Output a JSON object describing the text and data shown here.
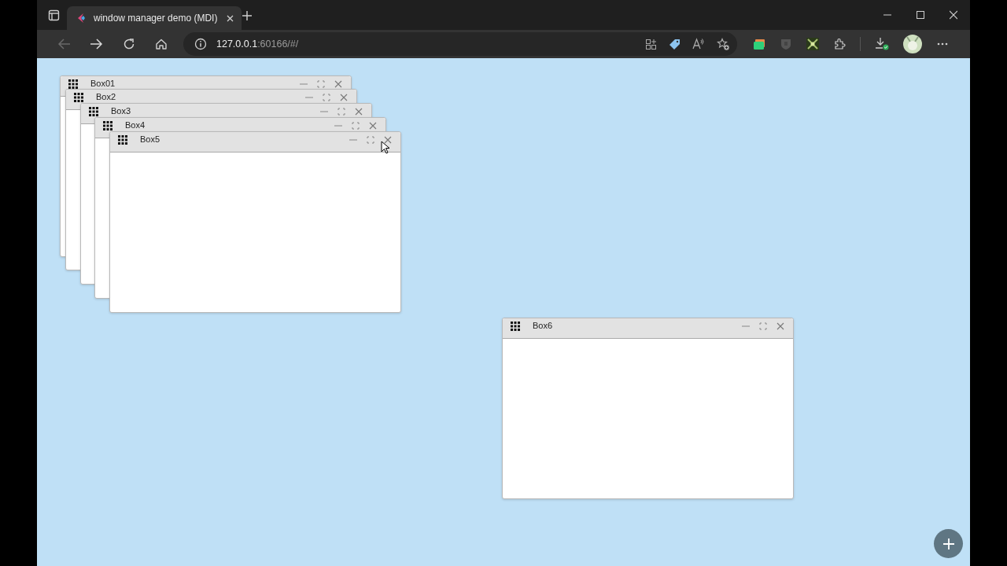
{
  "browser": {
    "tab": {
      "title": "window manager demo (MDI)",
      "selected": true
    },
    "back": {
      "disabled": true
    },
    "forward": {
      "disabled": false
    },
    "address": {
      "host": "127.0.0.1",
      "rest": ":60166/#/"
    }
  },
  "windows": [
    {
      "title": "Box01"
    },
    {
      "title": "Box2"
    },
    {
      "title": "Box3"
    },
    {
      "title": "Box4"
    },
    {
      "title": "Box5"
    },
    {
      "title": "Box6"
    }
  ]
}
